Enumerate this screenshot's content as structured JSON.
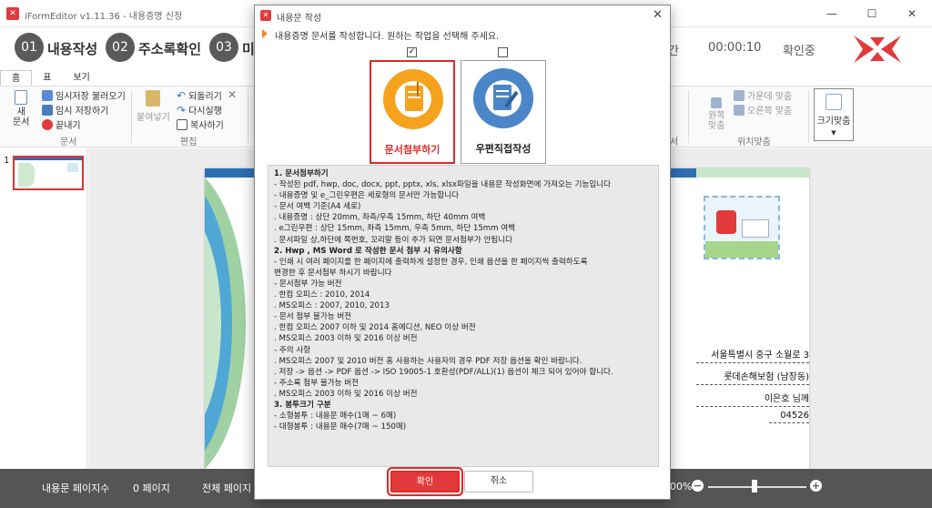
{
  "window": {
    "title": "iFormEditor v1.11.36 - 내용증명 신청"
  },
  "steps": [
    {
      "num": "01",
      "label": "내용작성"
    },
    {
      "num": "02",
      "label": "주소록확인"
    },
    {
      "num": "03",
      "label": "미"
    }
  ],
  "header_right": {
    "partial": "간",
    "timer": "00:00:10",
    "status": "확인중"
  },
  "menu_tabs": [
    "홈",
    "표",
    "보기"
  ],
  "ribbon": {
    "new_doc": "새\n문서",
    "temp_load": "임시저장 불러오기",
    "temp_save": "임시 저장하기",
    "exit": "끝내기",
    "group_doc": "문서",
    "paste": "붙여넣기",
    "undo": "되돌리기",
    "redo": "다시실행",
    "copy": "복사하기",
    "group_edit": "편집",
    "align_center": "가운데 맞춤",
    "align_right": "오른쪽 맞춤",
    "align_origin": "원쪽\n맞춤",
    "group_pos": "위치맞춤",
    "group_partial": "서",
    "fit_size": "크기맞춤"
  },
  "page_thumbnail_num": "1",
  "document": {
    "addr1": "서울특별시 중구 소월로 3",
    "addr2": "롯데손해보험 (남장동)",
    "addr3": "이은호 님께",
    "zip": "04526"
  },
  "statusbar": {
    "page_count_label": "내용문 페이지수",
    "page_count_value": "0 페이지",
    "total_label": "전체 페이지",
    "zoom": "00%"
  },
  "dialog": {
    "title": "내용문 작성",
    "instruction": "내용증명 문서를 작성합니다. 원하는 작업을 선택해 주세요.",
    "option_attach": {
      "label": "문서첨부하기",
      "checked": true
    },
    "option_direct": {
      "label": "우편직접작성",
      "checked": false
    },
    "info_lines": [
      {
        "h": true,
        "t": "1. 문서첨부하기"
      },
      {
        "h": false,
        "t": "- 작성된 pdf, hwp, doc, docx, ppt, pptx, xls, xlsx파일을 내용문 작성화면에 가져오는 기능입니다"
      },
      {
        "h": false,
        "t": "- 내용증명 및 e_그린우편은 세로형의 문서만 가능합니다"
      },
      {
        "h": false,
        "t": "- 문서 여백 기준(A4 세로)"
      },
      {
        "h": false,
        "t": ". 내용증명  : 상단 20mm, 좌측/우측 15mm, 하단 40mm 여백"
      },
      {
        "h": false,
        "t": ". e그린우편 : 상단 15mm, 좌측 15mm, 우측 5mm, 하단 15mm 여백"
      },
      {
        "h": false,
        "t": ". 문서파일 상,하단에 쪽번호, 꼬리말 등이 추가 되면 문서첨부가 안됩니다"
      },
      {
        "h": true,
        "t": "2. Hwp , MS Word 로 작성한 문서 첨부 시  유의사항"
      },
      {
        "h": false,
        "t": "- 인쇄 시 여러 페이지를 한 페이지에  출력하게 설정한 경우, 인쇄 옵션을 한 페이지씩 출력하도록"
      },
      {
        "h": false,
        "t": "  변경한 후 문서첨부 하시기 바랍니다"
      },
      {
        "h": false,
        "t": "- 문서첨부 가능 버전"
      },
      {
        "h": false,
        "t": ". 한컴 오피스 : 2010, 2014"
      },
      {
        "h": false,
        "t": ". MS오피스 : 2007, 2010, 2013"
      },
      {
        "h": false,
        "t": "- 문서 첨부 불가능 버전"
      },
      {
        "h": false,
        "t": ". 한컴 오피스 2007 이하 및 2014 홈에디션, NEO 이상 버전"
      },
      {
        "h": false,
        "t": ". MS오피스 2003 이하 및 2016 이상 버전"
      },
      {
        "h": false,
        "t": "- 주의 사항"
      },
      {
        "h": false,
        "t": ". MS오피스 2007 및 2010 버전 홈 사용하는 사용자의 경우 PDF 저장 옵션을 확인 바랍니다."
      },
      {
        "h": false,
        "t": ". 저장 -> 옵션 -> PDF 옵션 -> ISO 19005-1 호환성(PDF/ALL)(1) 옵션이 체크 되어 있어야 합니다."
      },
      {
        "h": false,
        "t": "- 주소록 첨부 불가능 버전"
      },
      {
        "h": false,
        "t": ". MS오피스 2003 이하 및 2016 이상 버전"
      },
      {
        "h": true,
        "t": "3. 봉투크기 구분"
      },
      {
        "h": false,
        "t": "- 소형봉투 : 내용문 매수(1매 ~ 6매)"
      },
      {
        "h": false,
        "t": "- 대형봉투 : 내용문 매수(7매 ~ 150매)"
      }
    ],
    "ok_label": "확인",
    "cancel_label": "취소"
  },
  "colors": {
    "accent": "#e23a3a",
    "step_circle": "#5a5a5a",
    "statusbar": "#555555"
  }
}
